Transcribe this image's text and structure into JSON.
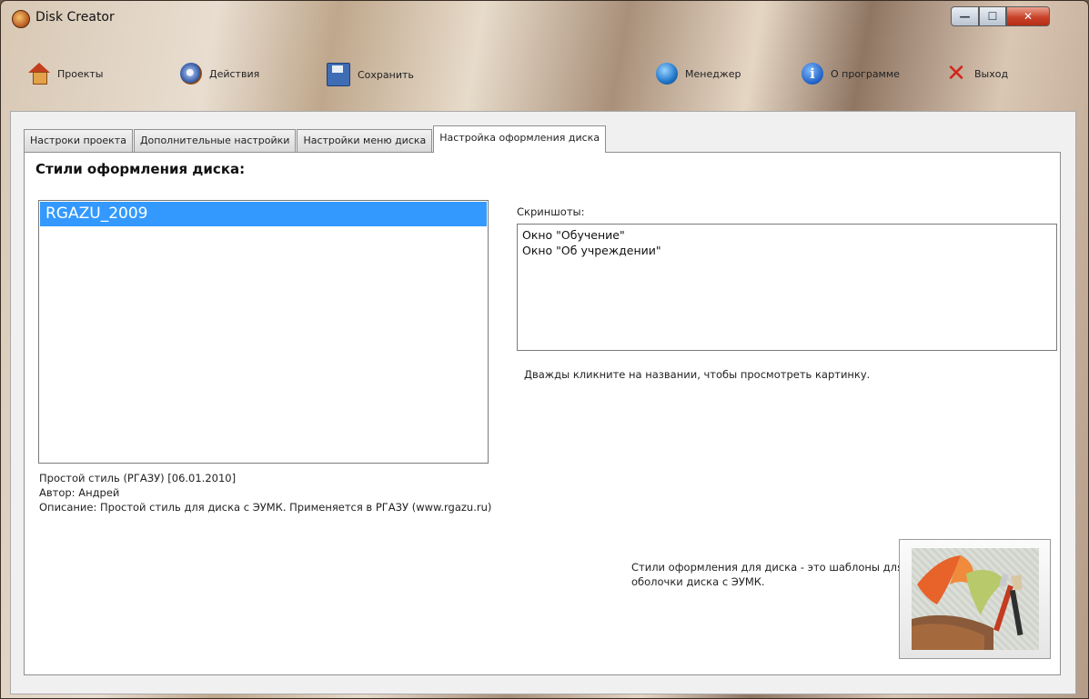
{
  "window": {
    "title": "Disk Creator"
  },
  "toolbar": {
    "projects": "Проекты",
    "actions": "Действия",
    "save": "Сохранить",
    "manager": "Менеджер",
    "about": "О программе",
    "exit": "Выход"
  },
  "tabs": [
    {
      "label": "Настроки проекта"
    },
    {
      "label": "Дополнительные настройки"
    },
    {
      "label": "Настройки меню диска"
    },
    {
      "label": "Настройка оформления диска",
      "active": true
    }
  ],
  "main": {
    "heading": "Стили оформления диска:",
    "styles": [
      "RGAZU_2009"
    ],
    "selected_style": "RGAZU_2009",
    "info": {
      "name": "Простой стиль (РГАЗУ) [06.01.2010]",
      "author": "Автор: Андрей",
      "description": "Описание: Простой стиль для диска с ЭУМК. Применяется в РГАЗУ (www.rgazu.ru)"
    },
    "screenshots_label": "Скриншоты:",
    "screenshots": [
      "Окно \"Обучение\"",
      "Окно \"Об учреждении\""
    ],
    "hint": "Дважды кликните на названии, чтобы просмотреть картинку.",
    "styles_description": "Стили оформления для диска - это шаблоны для оболочки диска с ЭУМК."
  },
  "colors": {
    "selection": "#3399ff",
    "close_button": "#c8432a"
  },
  "icons": {
    "projects": "house-icon",
    "actions": "gear-icon",
    "save": "floppy-disk-icon",
    "manager": "globe-icon",
    "about": "info-icon",
    "exit": "red-x-icon"
  }
}
